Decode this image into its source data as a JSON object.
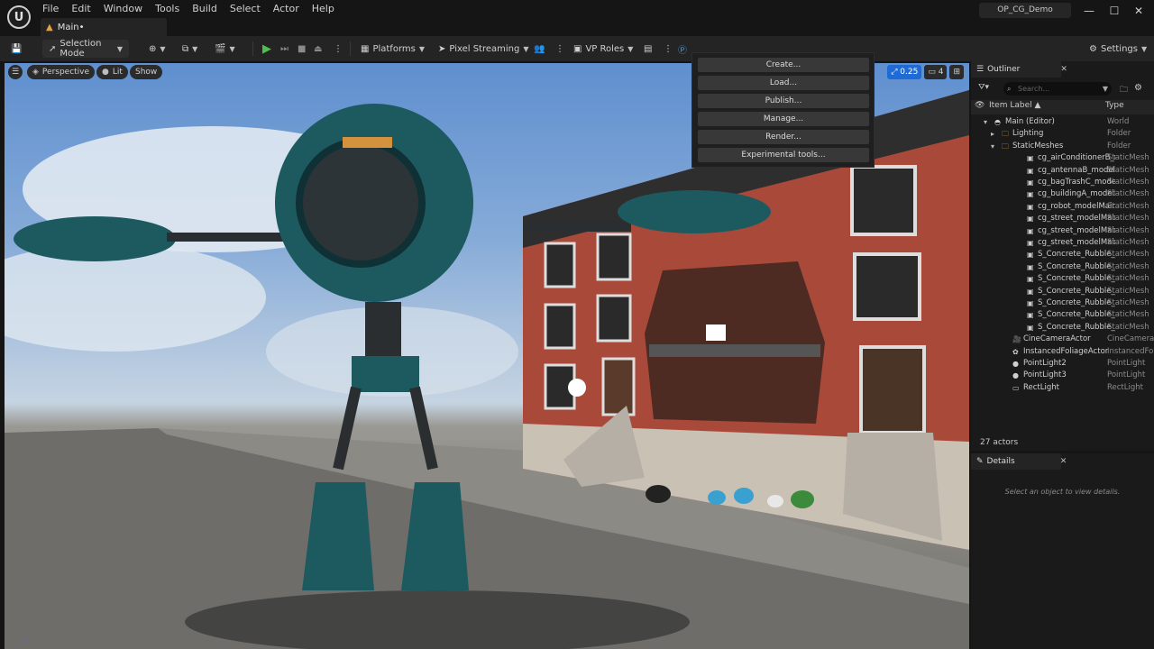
{
  "menu": [
    "File",
    "Edit",
    "Window",
    "Tools",
    "Build",
    "Select",
    "Actor",
    "Help"
  ],
  "level_tab": "Main•",
  "project_name": "OP_CG_Demo",
  "window_controls": {
    "minimize": "—",
    "maximize": "☐",
    "close": "✕"
  },
  "toolbar": {
    "selection_mode": "Selection Mode",
    "platforms": "Platforms",
    "pixel_streaming": "Pixel Streaming",
    "vp_roles": "VP Roles",
    "settings": "Settings"
  },
  "viewport": {
    "perspective": "Perspective",
    "lit": "Lit",
    "show": "Show",
    "camera_speed": "0.25",
    "camera_count": "4"
  },
  "dropdown": {
    "items": [
      "Create...",
      "Load...",
      "Publish...",
      "Manage...",
      "Render...",
      "Experimental tools..."
    ]
  },
  "outliner": {
    "tab": "Outliner",
    "search_placeholder": "Search...",
    "col_label": "Item Label ▲",
    "col_type": "Type",
    "rows": [
      {
        "label": "Main (Editor)",
        "type": "World"
      },
      {
        "label": "Lighting",
        "type": "Folder"
      },
      {
        "label": "StaticMeshes",
        "type": "Folder"
      },
      {
        "label": "cg_airConditionerB_m",
        "type": "StaticMesh"
      },
      {
        "label": "cg_antennaB_modelM",
        "type": "StaticMesh"
      },
      {
        "label": "cg_bagTrashC_modelI",
        "type": "StaticMesh"
      },
      {
        "label": "cg_buildingA_modelM",
        "type": "StaticMesh"
      },
      {
        "label": "cg_robot_modelMain_",
        "type": "StaticMesh"
      },
      {
        "label": "cg_street_modelMain_",
        "type": "StaticMesh"
      },
      {
        "label": "cg_street_modelMain_",
        "type": "StaticMesh"
      },
      {
        "label": "cg_street_modelMain_",
        "type": "StaticMesh"
      },
      {
        "label": "S_Concrete_Rubble_P",
        "type": "StaticMesh"
      },
      {
        "label": "S_Concrete_Rubble_P",
        "type": "StaticMesh"
      },
      {
        "label": "S_Concrete_Rubble_P",
        "type": "StaticMesh"
      },
      {
        "label": "S_Concrete_Rubble_P",
        "type": "StaticMesh"
      },
      {
        "label": "S_Concrete_Rubble_P",
        "type": "StaticMesh"
      },
      {
        "label": "S_Concrete_Rubble_P",
        "type": "StaticMesh"
      },
      {
        "label": "S_Concrete_Rubble_P",
        "type": "StaticMesh"
      },
      {
        "label": "CineCameraActor",
        "type": "CineCamera"
      },
      {
        "label": "InstancedFoliageActor",
        "type": "InstancedFo"
      },
      {
        "label": "PointLight2",
        "type": "PointLight"
      },
      {
        "label": "PointLight3",
        "type": "PointLight"
      },
      {
        "label": "RectLight",
        "type": "RectLight"
      }
    ],
    "actor_count": "27 actors"
  },
  "details": {
    "tab": "Details",
    "empty_message": "Select an object to view details."
  },
  "colors": {
    "accent": "#1f6bd6",
    "play_green": "#4fc04f",
    "folder": "#d9a441",
    "level_icon": "#e8a23a"
  }
}
